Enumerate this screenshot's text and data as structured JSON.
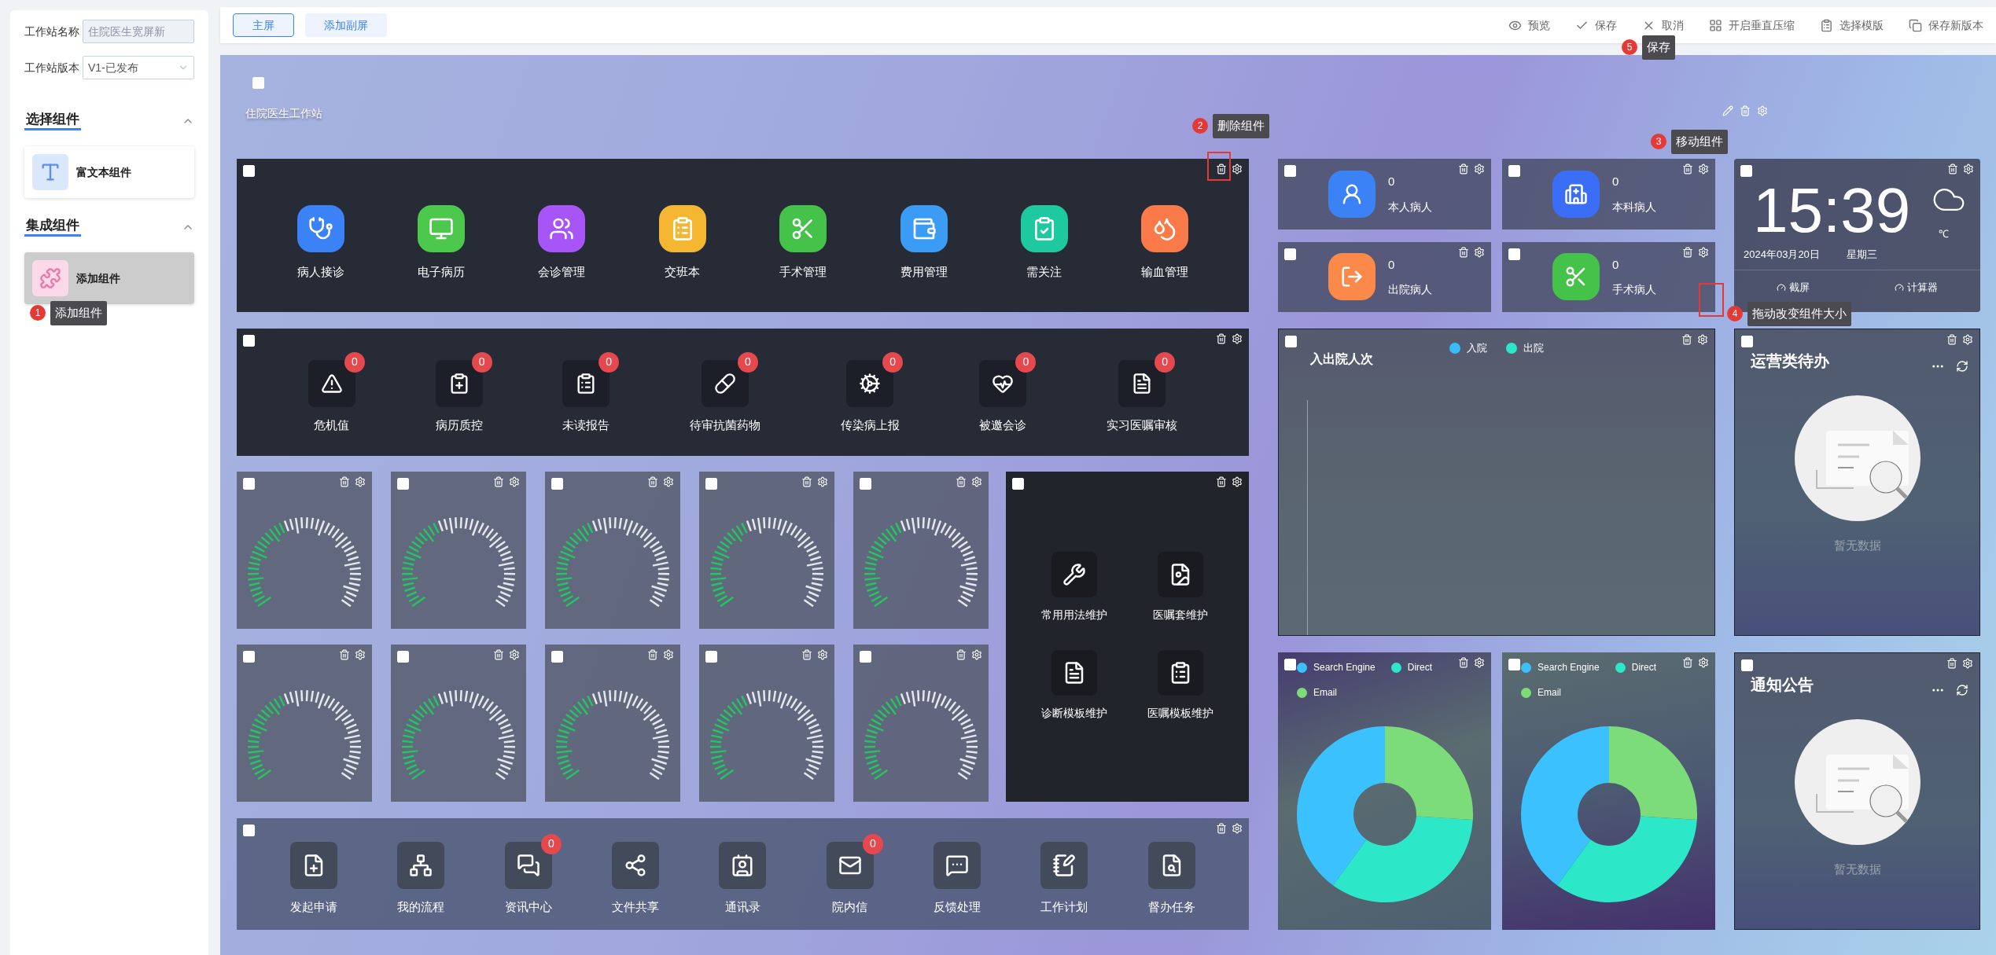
{
  "sidebar": {
    "fields": [
      {
        "label": "工作站名称",
        "value": "住院医生宽屏新",
        "disabled": true
      },
      {
        "label": "工作站版本",
        "value": "V1-已发布",
        "disabled": false
      }
    ],
    "sections": [
      {
        "title": "选择组件",
        "expanded": true,
        "items": [
          {
            "label": "富文本组件",
            "kind": "text",
            "selected": false
          }
        ]
      },
      {
        "title": "集成组件",
        "expanded": true,
        "items": [
          {
            "label": "添加组件",
            "kind": "puzzle",
            "selected": true
          }
        ]
      }
    ]
  },
  "screen_tabs": [
    {
      "label": "主屏",
      "selected": true
    },
    {
      "label": "添加副屏",
      "selected": false
    }
  ],
  "toolbar": [
    {
      "label": "预览",
      "kind": "eye"
    },
    {
      "label": "保存",
      "kind": "check"
    },
    {
      "label": "取消",
      "kind": "close"
    },
    {
      "label": "开启垂直压缩",
      "kind": "grid"
    },
    {
      "label": "选择模版",
      "kind": "clipboard"
    },
    {
      "label": "保存新版本",
      "kind": "copy"
    }
  ],
  "canvas": {
    "title": "住院医生工作站",
    "checked": false,
    "app_launcher": {
      "checked": false,
      "items": [
        {
          "label": "病人接诊",
          "kind": "stethoscope",
          "color": "#3b82f6"
        },
        {
          "label": "电子病历",
          "kind": "monitor",
          "color": "#4cc94c"
        },
        {
          "label": "会诊管理",
          "kind": "users",
          "color": "#a855f7"
        },
        {
          "label": "交班本",
          "kind": "clipboard",
          "color": "#f5b731"
        },
        {
          "label": "手术管理",
          "kind": "scalpel",
          "color": "#45c24a"
        },
        {
          "label": "费用管理",
          "kind": "wallet",
          "color": "#3b9cf6"
        },
        {
          "label": "需关注",
          "kind": "clipboard-check",
          "color": "#1ec9a0"
        },
        {
          "label": "输血管理",
          "kind": "drops",
          "color": "#fb7a4a"
        }
      ]
    },
    "alerts": {
      "checked": false,
      "items": [
        {
          "label": "危机值",
          "count": "0",
          "kind": "warning"
        },
        {
          "label": "病历质控",
          "count": "0",
          "kind": "clipboard-plus"
        },
        {
          "label": "未读报告",
          "count": "0",
          "kind": "clipboard"
        },
        {
          "label": "待审抗菌药物",
          "count": "0",
          "kind": "pill"
        },
        {
          "label": "传染病上报",
          "count": "0",
          "kind": "gear"
        },
        {
          "label": "被邀会诊",
          "count": "0",
          "kind": "heart"
        },
        {
          "label": "实习医嘱审核",
          "count": "0",
          "kind": "document"
        }
      ]
    },
    "gauges": [
      {
        "checked": false
      },
      {
        "checked": false
      },
      {
        "checked": false
      },
      {
        "checked": false
      },
      {
        "checked": false
      },
      {
        "checked": false
      },
      {
        "checked": false
      },
      {
        "checked": false
      },
      {
        "checked": false
      },
      {
        "checked": false
      }
    ],
    "maintenance": {
      "checked": false,
      "items": [
        {
          "label": "常用用法维护",
          "kind": "wrench"
        },
        {
          "label": "医嘱套维护",
          "kind": "file-image"
        },
        {
          "label": "诊断模板维护",
          "kind": "document"
        },
        {
          "label": "医嘱模板维护",
          "kind": "clipboard"
        }
      ]
    },
    "office": {
      "checked": false,
      "items": [
        {
          "label": "发起申请",
          "kind": "file-plus"
        },
        {
          "label": "我的流程",
          "kind": "network"
        },
        {
          "label": "资讯中心",
          "kind": "chat",
          "count": "0"
        },
        {
          "label": "文件共享",
          "kind": "share"
        },
        {
          "label": "通讯录",
          "kind": "contact"
        },
        {
          "label": "院内信",
          "kind": "mail",
          "count": "0"
        },
        {
          "label": "反馈处理",
          "kind": "chat-more"
        },
        {
          "label": "工作计划",
          "kind": "notebook"
        },
        {
          "label": "督办任务",
          "kind": "file-search"
        }
      ]
    },
    "patient_stats": [
      {
        "value": "0",
        "label": "本人病人",
        "kind": "user",
        "color": "#3b82f6",
        "checked": false
      },
      {
        "value": "0",
        "label": "本科病人",
        "kind": "hospital",
        "color": "#3b6ef6",
        "checked": false
      },
      {
        "value": "0",
        "label": "出院病人",
        "kind": "discharge",
        "color": "#fb8a4a",
        "checked": false
      },
      {
        "value": "0",
        "label": "手术病人",
        "kind": "scalpel",
        "color": "#45c24a",
        "checked": false
      }
    ],
    "clock": {
      "checked": false,
      "time": "15:39",
      "date": "2024年03月20日",
      "weekday": "星期三",
      "temperature_unit": "℃",
      "actions": [
        "截屏",
        "计算器"
      ]
    },
    "admission_chart": {
      "checked": false,
      "title": "入出院人次",
      "legend": [
        {
          "name": "入院",
          "color": "#38bdf8"
        },
        {
          "name": "出院",
          "color": "#2de8c8"
        }
      ]
    },
    "todo": {
      "checked": false,
      "title": "运营类待办",
      "empty_text": "暂无数据"
    },
    "traffic_pies": [
      {
        "checked": false,
        "legend": [
          {
            "name": "Search Engine",
            "color": "#3bc1fd"
          },
          {
            "name": "Direct",
            "color": "#2de8c8"
          },
          {
            "name": "Email",
            "color": "#7cdc7a"
          }
        ]
      },
      {
        "checked": false,
        "legend": [
          {
            "name": "Search Engine",
            "color": "#3bc1fd"
          },
          {
            "name": "Direct",
            "color": "#2de8c8"
          },
          {
            "name": "Email",
            "color": "#7cdc7a"
          }
        ]
      }
    ],
    "notice": {
      "checked": false,
      "title": "通知公告",
      "empty_text": "暂无数据"
    }
  },
  "annotations": [
    {
      "number": "1",
      "text": "添加组件"
    },
    {
      "number": "2",
      "text": "删除组件"
    },
    {
      "number": "3",
      "text": "移动组件"
    },
    {
      "number": "4",
      "text": "拖动改变组件大小"
    },
    {
      "number": "5",
      "text": "保存"
    }
  ]
}
